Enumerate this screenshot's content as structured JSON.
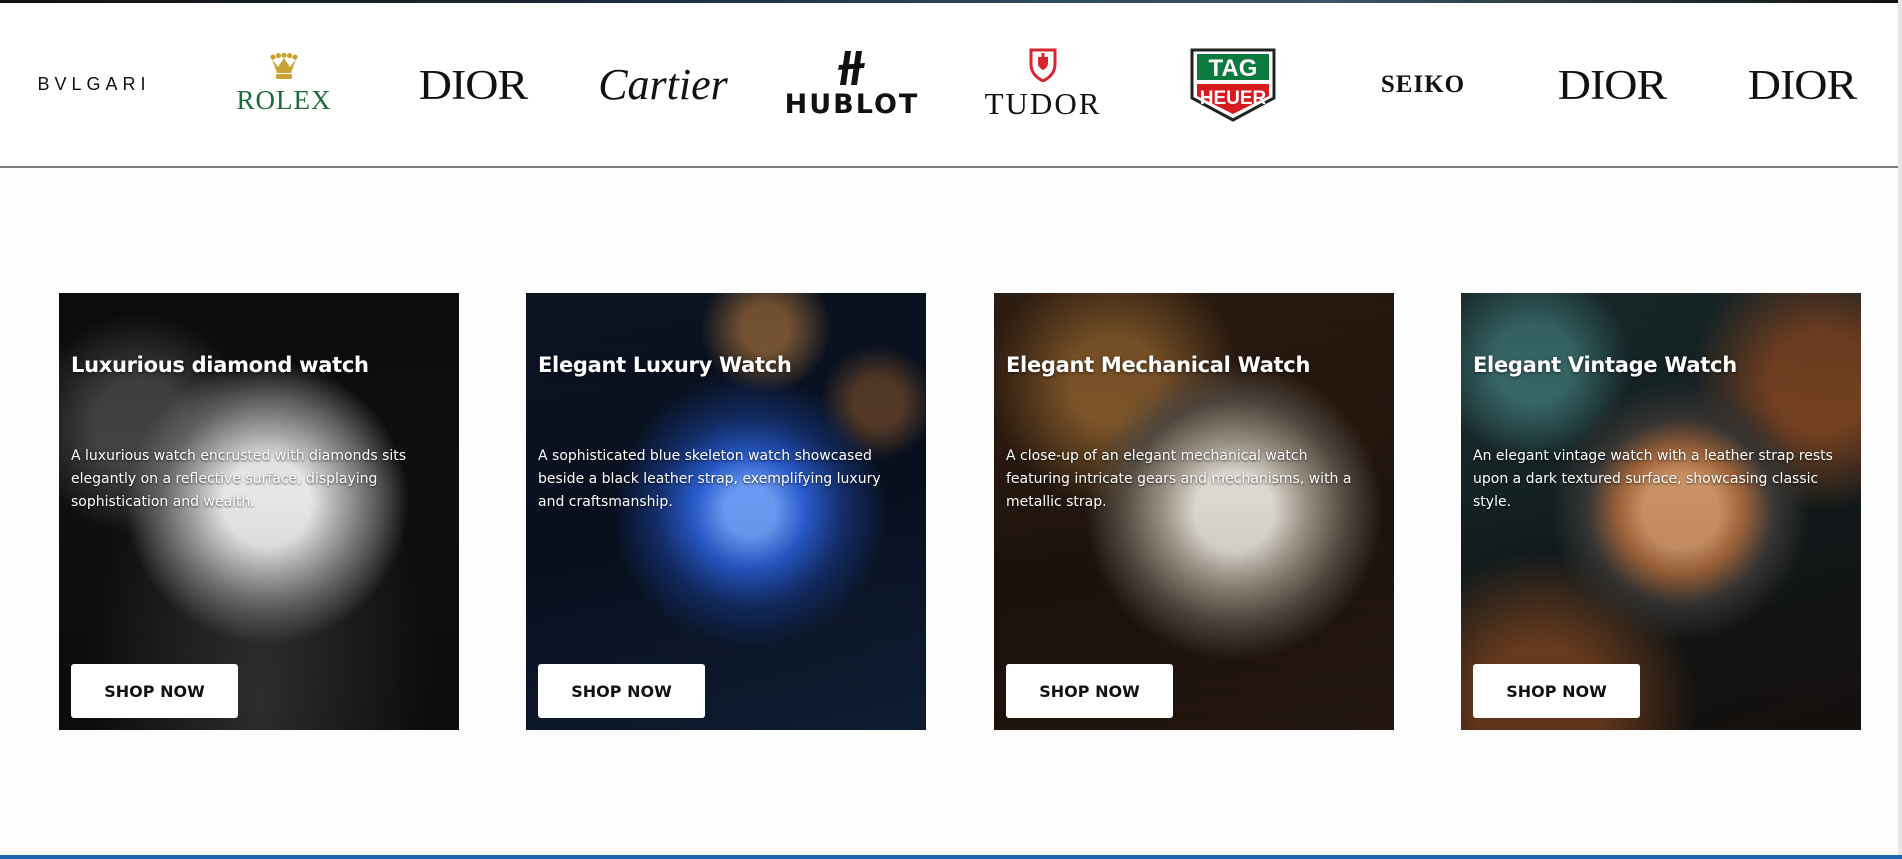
{
  "brands": [
    {
      "name": "BVLGARI",
      "icon": "bvlgari-logo"
    },
    {
      "name": "ROLEX",
      "icon": "rolex-crown-logo"
    },
    {
      "name": "DIOR",
      "icon": "dior-logo"
    },
    {
      "name": "Cartier",
      "icon": "cartier-logo"
    },
    {
      "name": "HUBLOT",
      "icon": "hublot-logo"
    },
    {
      "name": "TUDOR",
      "icon": "tudor-shield-logo"
    },
    {
      "name": "TAG HEUER",
      "icon": "tag-heuer-logo"
    },
    {
      "name": "SEIKO",
      "icon": "seiko-logo"
    },
    {
      "name": "DIOR",
      "icon": "dior-logo"
    },
    {
      "name": "DIOR",
      "icon": "dior-logo"
    }
  ],
  "cards": [
    {
      "title": "Luxurious diamond watch",
      "description": "A luxurious watch encrusted with diamonds sits elegantly on a reflective surface, displaying sophistication and wealth.",
      "button": "SHOP NOW"
    },
    {
      "title": "Elegant Luxury Watch",
      "description": "A sophisticated blue skeleton watch showcased beside a black leather strap, exemplifying luxury and craftsmanship.",
      "button": "SHOP NOW"
    },
    {
      "title": "Elegant Mechanical Watch",
      "description": "A close-up of an elegant mechanical watch featuring intricate gears and mechanisms, with a metallic strap.",
      "button": "SHOP NOW"
    },
    {
      "title": "Elegant Vintage Watch",
      "description": "An elegant vintage watch with a leather strap rests upon a dark textured surface, showcasing classic style.",
      "button": "SHOP NOW"
    }
  ],
  "colors": {
    "rolex_green": "#1d6a3a",
    "tudor_red": "#d8262f",
    "tag_green": "#0b7a3e",
    "tag_red": "#d71920",
    "footer_blue": "#1d63b0"
  }
}
